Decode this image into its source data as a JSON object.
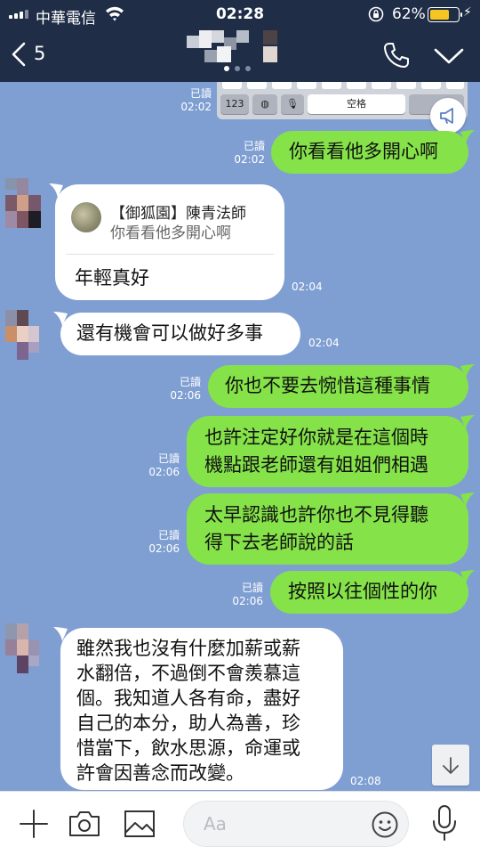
{
  "status_bar": {
    "carrier": "中華電信",
    "time": "02:28",
    "battery_percent": "62%",
    "battery_level": 0.62
  },
  "header": {
    "back_count": "5",
    "contact_name_hidden": true
  },
  "keyboard_snippet": {
    "key_123": "123",
    "key_space": "空格"
  },
  "messages": [
    {
      "side": "right",
      "read": "已讀",
      "time": "02:02",
      "text": "你看看他多開心啊"
    },
    {
      "side": "left",
      "reply_to": {
        "name": "【御狐園】陳青法師",
        "text": "你看看他多開心啊"
      },
      "text": "年輕真好",
      "time": "02:04"
    },
    {
      "side": "left",
      "text": "還有機會可以做好多事",
      "time": "02:04"
    },
    {
      "side": "right",
      "read": "已讀",
      "time": "02:06",
      "text": "你也不要去惋惜這種事情"
    },
    {
      "side": "right",
      "read": "已讀",
      "time": "02:06",
      "lines": [
        "也許注定好你就是在這個時",
        "機點跟老師還有姐姐們相遇"
      ]
    },
    {
      "side": "right",
      "read": "已讀",
      "time": "02:06",
      "lines": [
        "太早認識也許你也不見得聽",
        "得下去老師說的話"
      ]
    },
    {
      "side": "right",
      "read": "已讀",
      "time": "02:06",
      "text": "按照以往個性的你"
    },
    {
      "side": "left",
      "time": "02:08",
      "lines": [
        "雖然我也沒有什麼加薪或薪",
        "水翻倍，不過倒不會羨慕這",
        "個。我知道人各有命，盡好",
        "自己的本分，助人為善，珍",
        "惜當下，飲水思源，命運或",
        "許會因善念而改變。"
      ]
    }
  ],
  "first_read": {
    "read": "已讀",
    "time": "02:02"
  },
  "composer": {
    "placeholder": "Aa"
  },
  "colors": {
    "header_bg": "#1f2d47",
    "chat_bg": "#7f9fd2",
    "sent_bubble": "#85e249",
    "received_bubble": "#ffffff",
    "battery_fill": "#f5c521"
  },
  "icons": [
    "back-icon",
    "call-icon",
    "chevron-down-icon",
    "announcement-icon",
    "scroll-down-icon",
    "plus-icon",
    "camera-icon",
    "image-icon",
    "emoji-icon",
    "microphone-icon"
  ]
}
